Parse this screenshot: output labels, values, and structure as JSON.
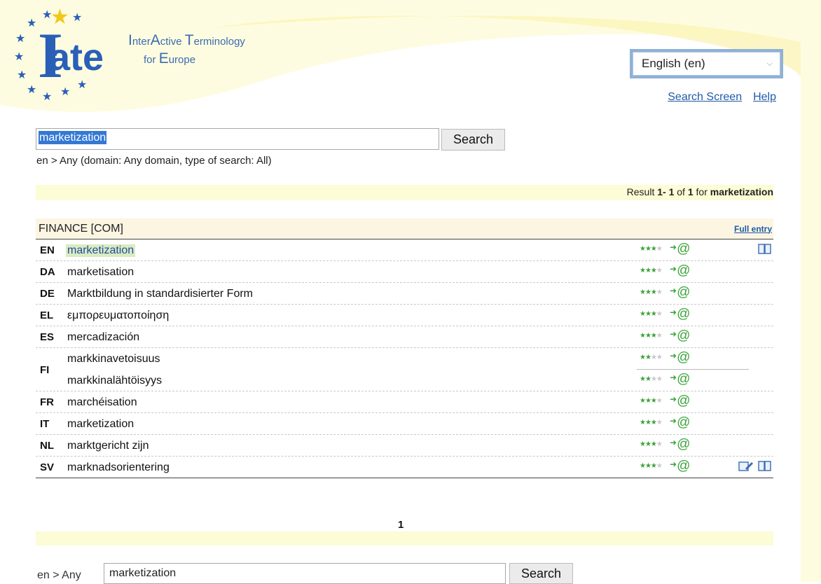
{
  "header": {
    "logo_word": "ate",
    "logo_letter": "I",
    "tagline_line1": [
      "I",
      "nter",
      "A",
      "ctive ",
      "T",
      "erminology"
    ],
    "tagline_line2": [
      "for ",
      "E",
      "urope"
    ],
    "language_selected": "English (en)",
    "links": {
      "search_screen": "Search Screen",
      "help": "Help"
    }
  },
  "search_top": {
    "value": "marketization",
    "button": "Search",
    "breadcrumb": "en > Any (domain: Any domain, type of search: All)"
  },
  "results": {
    "prefix": "Result ",
    "range": "1- 1",
    "of": " of ",
    "total": "1",
    "for": " for ",
    "query": "marketization"
  },
  "entry": {
    "domain": "FINANCE [COM]",
    "full_entry_link": "Full entry",
    "rows": [
      {
        "lang": "EN",
        "term": "marketization",
        "rating": 3,
        "highlight": true,
        "icons": [
          "book-icon"
        ]
      },
      {
        "lang": "DA",
        "term": "marketisation",
        "rating": 3
      },
      {
        "lang": "DE",
        "term": "Marktbildung in standardisierter Form",
        "rating": 3
      },
      {
        "lang": "EL",
        "term": "εμπορευματοποίηση",
        "rating": 3
      },
      {
        "lang": "ES",
        "term": "mercadización",
        "rating": 3
      },
      {
        "lang": "FI",
        "terms": [
          {
            "term": "markkinavetoisuus",
            "rating": 2
          },
          {
            "term": "markkinalähtöisyys",
            "rating": 2
          }
        ]
      },
      {
        "lang": "FR",
        "term": "marchéisation",
        "rating": 3
      },
      {
        "lang": "IT",
        "term": "marketization",
        "rating": 3
      },
      {
        "lang": "NL",
        "term": "marktgericht zijn",
        "rating": 3
      },
      {
        "lang": "SV",
        "term": "marknadsorientering",
        "rating": 3,
        "icons": [
          "note-edit-icon",
          "book-icon"
        ]
      }
    ]
  },
  "pager": {
    "current": "1"
  },
  "search_bottom": {
    "breadcrumb": "en > Any",
    "value": "marketization",
    "button": "Search"
  },
  "colors": {
    "accent_blue": "#1f5aa8",
    "result_bar": "#fcfcd6",
    "domain_bar": "#fbf5e2",
    "rating_green": "#3ea13a"
  }
}
